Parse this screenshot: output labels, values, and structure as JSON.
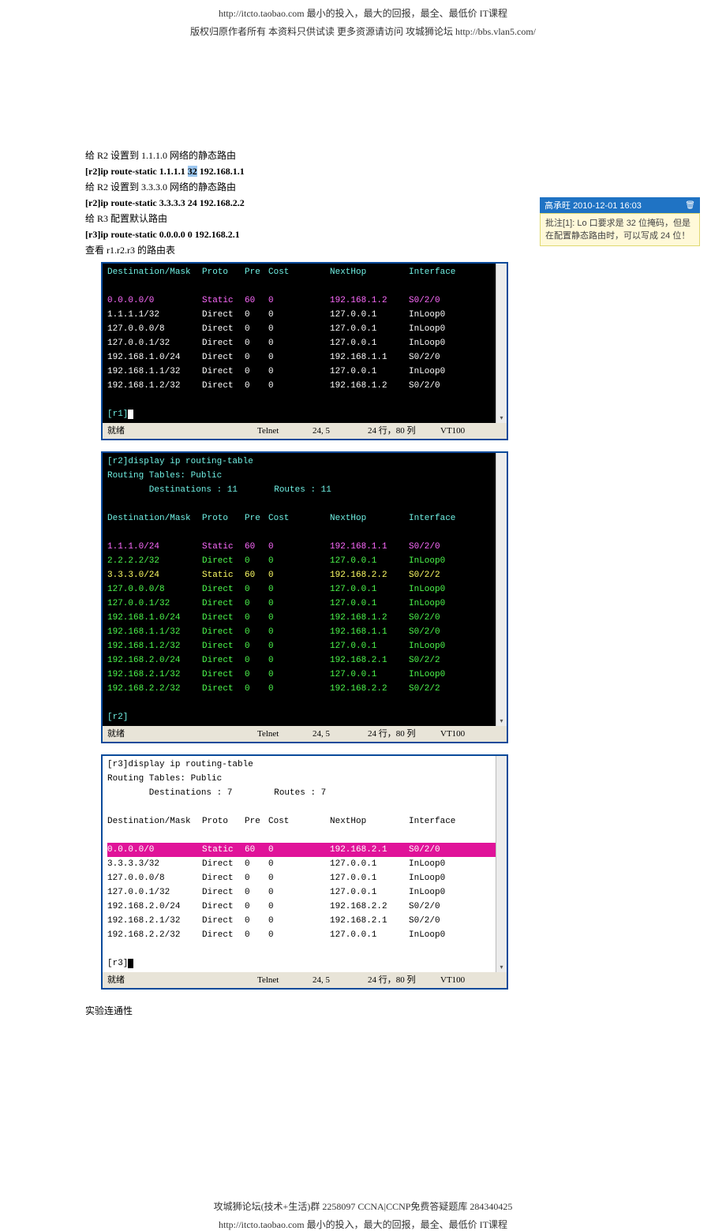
{
  "header": {
    "line1": "http://itcto.taobao.com            最小的投入，最大的回报，最全、最低价 IT课程",
    "line2": "版权归原作者所有 本资料只供试读 更多资源请访问 攻城狮论坛 http://bbs.vlan5.com/"
  },
  "body": {
    "l1": "给 R2 设置到 1.1.1.0 网络的静态路由",
    "l2a": "[r2]ip route-static 1.1.1.1 ",
    "l2b": "32",
    "l2c": " 192.168.1.1",
    "l3": "给 R2 设置到 3.3.3.0 网络的静态路由",
    "l4": "[r2]ip route-static 3.3.3.3 24 192.168.2.2",
    "l5": "给 R3 配置默认路由",
    "l6": "[r3]ip route-static 0.0.0.0 0 192.168.2.1",
    "l7": "查看 r1.r2.r3 的路由表",
    "l8": "实验连通性"
  },
  "annot": {
    "author": "高承旺",
    "time": "2010-12-01 16:03",
    "text": "批注[1]: Lo 口要求是 32 位掩码，但是在配置静态路由时，可以写成 24 位！"
  },
  "term1": {
    "hdr": {
      "d": "Destination/Mask",
      "p": "Proto",
      "pr": "Pre",
      "c": "Cost",
      "n": "NextHop",
      "i": "Interface"
    },
    "rows": [
      {
        "d": "0.0.0.0/0",
        "p": "Static",
        "pr": "60",
        "c": "0",
        "n": "192.168.1.2",
        "i": "S0/2/0",
        "cls": "c-mag"
      },
      {
        "d": "1.1.1.1/32",
        "p": "Direct",
        "pr": "0",
        "c": "0",
        "n": "127.0.0.1",
        "i": "InLoop0",
        "cls": "c-white"
      },
      {
        "d": "127.0.0.0/8",
        "p": "Direct",
        "pr": "0",
        "c": "0",
        "n": "127.0.0.1",
        "i": "InLoop0",
        "cls": "c-white"
      },
      {
        "d": "127.0.0.1/32",
        "p": "Direct",
        "pr": "0",
        "c": "0",
        "n": "127.0.0.1",
        "i": "InLoop0",
        "cls": "c-white"
      },
      {
        "d": "192.168.1.0/24",
        "p": "Direct",
        "pr": "0",
        "c": "0",
        "n": "192.168.1.1",
        "i": "S0/2/0",
        "cls": "c-white"
      },
      {
        "d": "192.168.1.1/32",
        "p": "Direct",
        "pr": "0",
        "c": "0",
        "n": "127.0.0.1",
        "i": "InLoop0",
        "cls": "c-white"
      },
      {
        "d": "192.168.1.2/32",
        "p": "Direct",
        "pr": "0",
        "c": "0",
        "n": "192.168.1.2",
        "i": "S0/2/0",
        "cls": "c-white"
      }
    ],
    "prompt": "[r1]",
    "status": {
      "ready": "就绪",
      "proto": "Telnet",
      "rc": "24, 5",
      "rc2": "24 行，80 列",
      "term": "VT100"
    }
  },
  "term2": {
    "pre1": "[r2]display ip routing-table",
    "pre2": "Routing Tables: Public",
    "pre3": "        Destinations : 11       Routes : 11",
    "hdr": {
      "d": "Destination/Mask",
      "p": "Proto",
      "pr": "Pre",
      "c": "Cost",
      "n": "NextHop",
      "i": "Interface"
    },
    "rows": [
      {
        "d": "1.1.1.0/24",
        "p": "Static",
        "pr": "60",
        "c": "0",
        "n": "192.168.1.1",
        "i": "S0/2/0",
        "cls": "c-mag"
      },
      {
        "d": "2.2.2.2/32",
        "p": "Direct",
        "pr": "0",
        "c": "0",
        "n": "127.0.0.1",
        "i": "InLoop0",
        "cls": "c-green"
      },
      {
        "d": "3.3.3.0/24",
        "p": "Static",
        "pr": "60",
        "c": "0",
        "n": "192.168.2.2",
        "i": "S0/2/2",
        "cls": "c-yel"
      },
      {
        "d": "127.0.0.0/8",
        "p": "Direct",
        "pr": "0",
        "c": "0",
        "n": "127.0.0.1",
        "i": "InLoop0",
        "cls": "c-green"
      },
      {
        "d": "127.0.0.1/32",
        "p": "Direct",
        "pr": "0",
        "c": "0",
        "n": "127.0.0.1",
        "i": "InLoop0",
        "cls": "c-green"
      },
      {
        "d": "192.168.1.0/24",
        "p": "Direct",
        "pr": "0",
        "c": "0",
        "n": "192.168.1.2",
        "i": "S0/2/0",
        "cls": "c-green"
      },
      {
        "d": "192.168.1.1/32",
        "p": "Direct",
        "pr": "0",
        "c": "0",
        "n": "192.168.1.1",
        "i": "S0/2/0",
        "cls": "c-green"
      },
      {
        "d": "192.168.1.2/32",
        "p": "Direct",
        "pr": "0",
        "c": "0",
        "n": "127.0.0.1",
        "i": "InLoop0",
        "cls": "c-green"
      },
      {
        "d": "192.168.2.0/24",
        "p": "Direct",
        "pr": "0",
        "c": "0",
        "n": "192.168.2.1",
        "i": "S0/2/2",
        "cls": "c-green"
      },
      {
        "d": "192.168.2.1/32",
        "p": "Direct",
        "pr": "0",
        "c": "0",
        "n": "127.0.0.1",
        "i": "InLoop0",
        "cls": "c-green"
      },
      {
        "d": "192.168.2.2/32",
        "p": "Direct",
        "pr": "0",
        "c": "0",
        "n": "192.168.2.2",
        "i": "S0/2/2",
        "cls": "c-green"
      }
    ],
    "prompt": "[r2]",
    "status": {
      "ready": "就绪",
      "proto": "Telnet",
      "rc": "24, 5",
      "rc2": "24 行，80 列",
      "term": "VT100"
    }
  },
  "term3": {
    "pre1": "[r3]display ip routing-table",
    "pre2": "Routing Tables: Public",
    "pre3": "        Destinations : 7        Routes : 7",
    "hdr": {
      "d": "Destination/Mask",
      "p": "Proto",
      "pr": "Pre",
      "c": "Cost",
      "n": "NextHop",
      "i": "Interface"
    },
    "rows": [
      {
        "d": "0.0.0.0/0",
        "p": "Static",
        "pr": "60",
        "c": "0",
        "n": "192.168.2.1",
        "i": "S0/2/0",
        "cls": "bg-mag"
      },
      {
        "d": "3.3.3.3/32",
        "p": "Direct",
        "pr": "0",
        "c": "0",
        "n": "127.0.0.1",
        "i": "InLoop0",
        "cls": ""
      },
      {
        "d": "127.0.0.0/8",
        "p": "Direct",
        "pr": "0",
        "c": "0",
        "n": "127.0.0.1",
        "i": "InLoop0",
        "cls": ""
      },
      {
        "d": "127.0.0.1/32",
        "p": "Direct",
        "pr": "0",
        "c": "0",
        "n": "127.0.0.1",
        "i": "InLoop0",
        "cls": ""
      },
      {
        "d": "192.168.2.0/24",
        "p": "Direct",
        "pr": "0",
        "c": "0",
        "n": "192.168.2.2",
        "i": "S0/2/0",
        "cls": ""
      },
      {
        "d": "192.168.2.1/32",
        "p": "Direct",
        "pr": "0",
        "c": "0",
        "n": "192.168.2.1",
        "i": "S0/2/0",
        "cls": ""
      },
      {
        "d": "192.168.2.2/32",
        "p": "Direct",
        "pr": "0",
        "c": "0",
        "n": "127.0.0.1",
        "i": "InLoop0",
        "cls": ""
      }
    ],
    "prompt": "[r3]",
    "status": {
      "ready": "就绪",
      "proto": "Telnet",
      "rc": "24, 5",
      "rc2": "24 行，80 列",
      "term": "VT100"
    }
  },
  "footer": {
    "line1": "攻城狮论坛(技术+生活)群 2258097 CCNA|CCNP免费答疑题库 284340425",
    "line2": "http://itcto.taobao.com            最小的投入，最大的回报，最全、最低价 IT课程"
  }
}
